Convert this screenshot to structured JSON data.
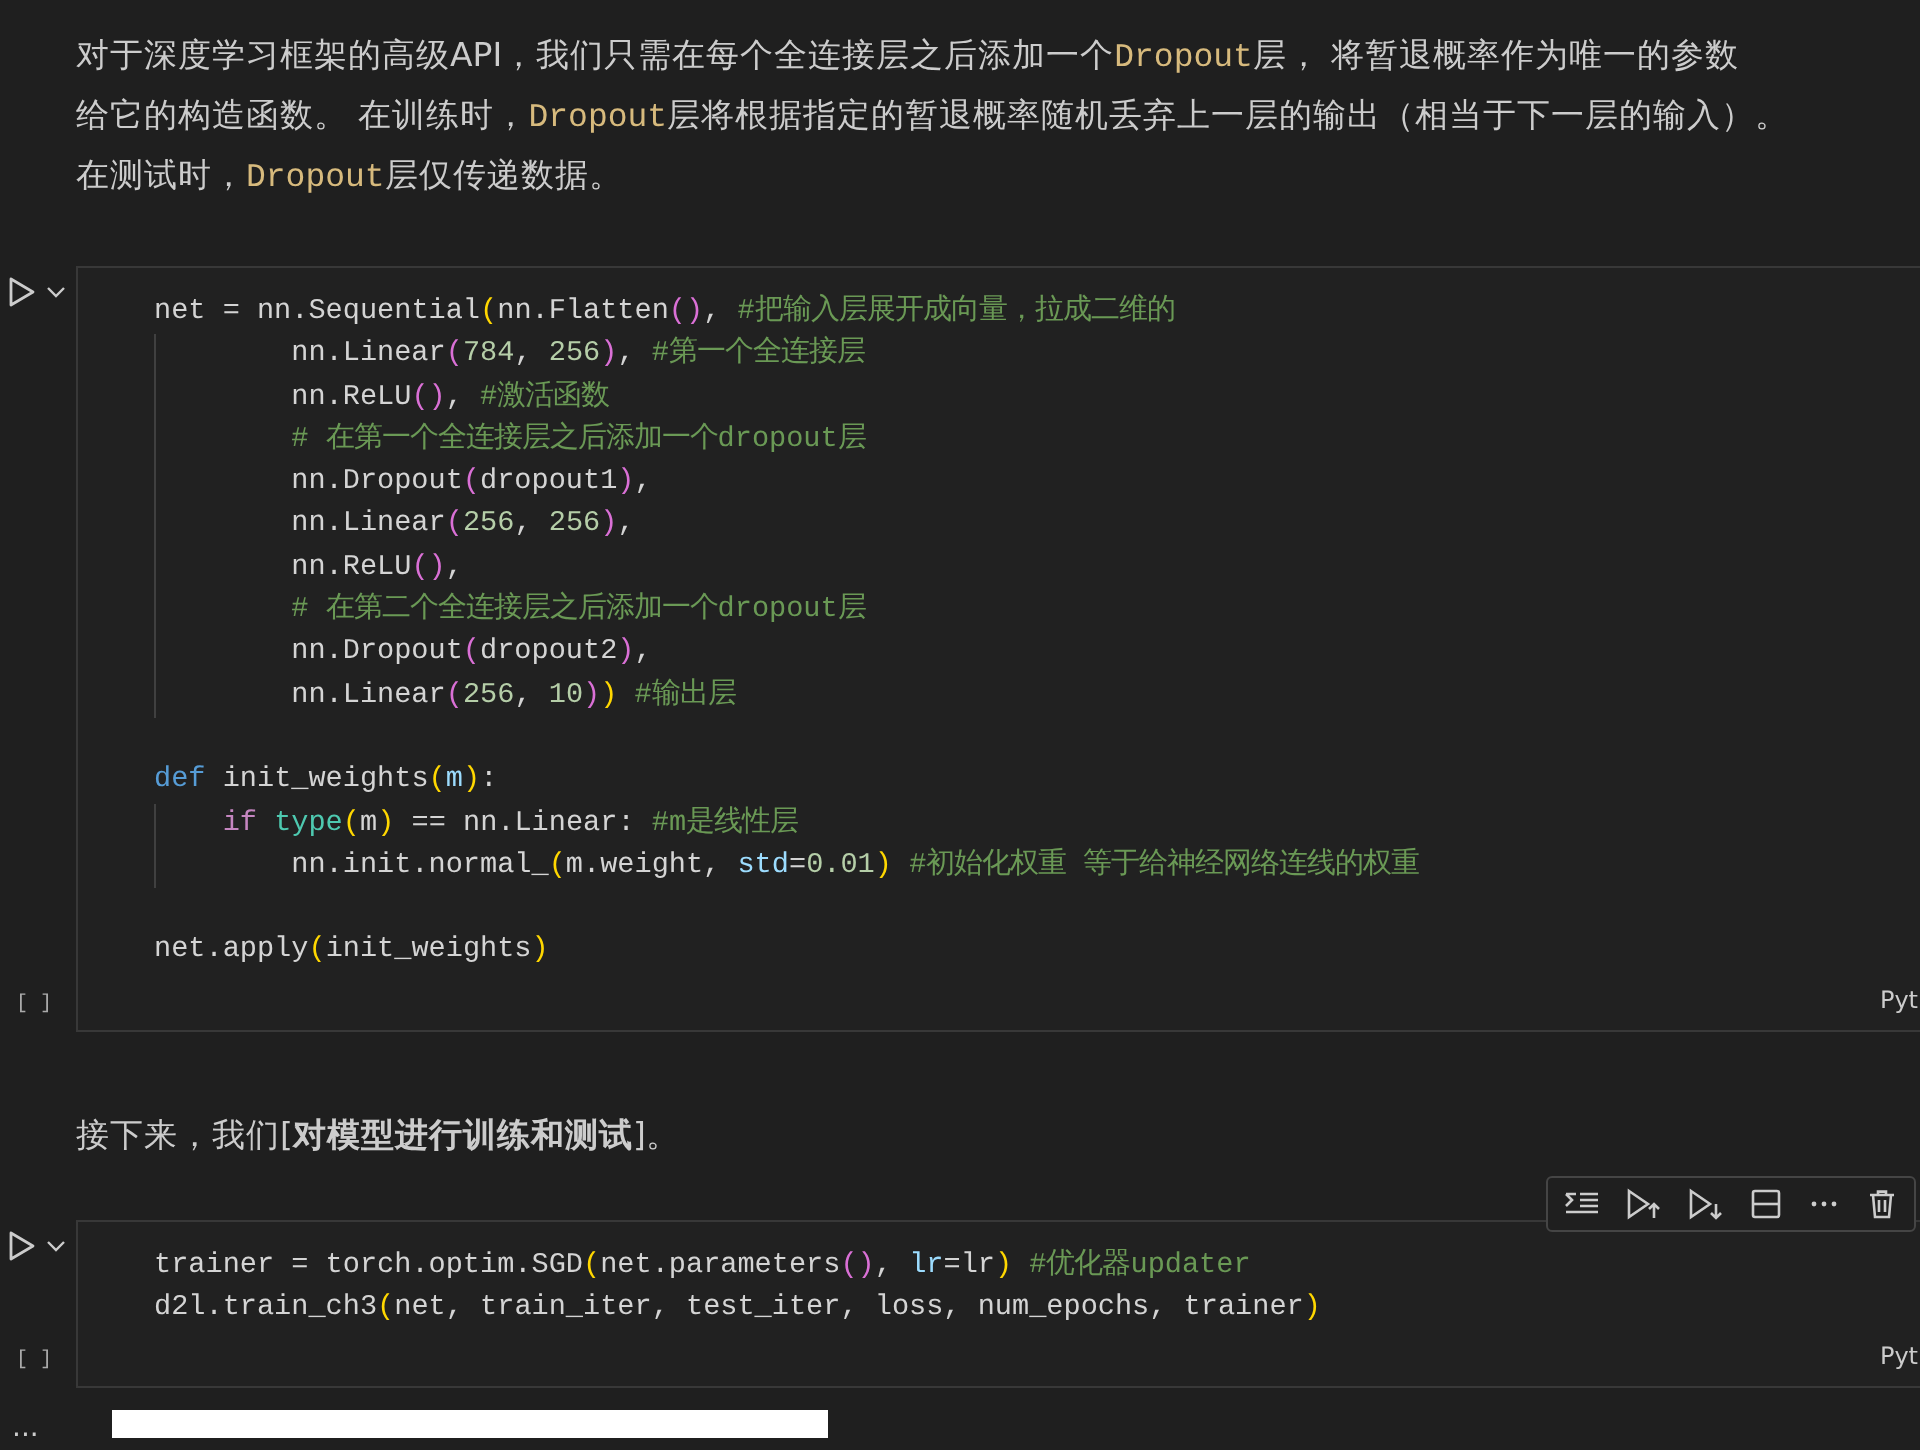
{
  "cells": [
    {
      "kind": "markdown",
      "lines": [
        [
          {
            "kind": "text",
            "text": "对于深度学习框架的高级API，我们只需在每个全连接层之后添加一个"
          },
          {
            "kind": "code",
            "text": "Dropout"
          },
          {
            "kind": "text",
            "text": "层， 将暂退概率作为唯一的参数"
          }
        ],
        [
          {
            "kind": "text",
            "text": "给它的构造函数。 在训练时，"
          },
          {
            "kind": "code",
            "text": "Dropout"
          },
          {
            "kind": "text",
            "text": "层将根据指定的暂退概率随机丢弃上一层的输出（相当于下一层的输入）。"
          }
        ],
        [
          {
            "kind": "text",
            "text": "在测试时，"
          },
          {
            "kind": "code",
            "text": "Dropout"
          },
          {
            "kind": "text",
            "text": "层仅传递数据。"
          }
        ]
      ]
    },
    {
      "kind": "code",
      "exec_label": "[ ]",
      "language": "Pyt",
      "lines": [
        {
          "kind": "code",
          "tokens": [
            {
              "kind": "plain",
              "text": "net = nn.Sequential"
            },
            {
              "kind": "b1",
              "text": "("
            },
            {
              "kind": "plain",
              "text": "nn.Flatten"
            },
            {
              "kind": "b2",
              "text": "()"
            },
            {
              "kind": "plain",
              "text": ", "
            },
            {
              "kind": "comment",
              "text": "#把输入层展开成向量，拉成二维的"
            }
          ]
        },
        {
          "kind": "indent2",
          "tokens": [
            {
              "kind": "plain",
              "text": "nn.Linear"
            },
            {
              "kind": "b2",
              "text": "("
            },
            {
              "kind": "number",
              "text": "784"
            },
            {
              "kind": "plain",
              "text": ", "
            },
            {
              "kind": "number",
              "text": "256"
            },
            {
              "kind": "b2",
              "text": ")"
            },
            {
              "kind": "plain",
              "text": ", "
            },
            {
              "kind": "comment",
              "text": "#第一个全连接层"
            }
          ]
        },
        {
          "kind": "indent2",
          "tokens": [
            {
              "kind": "plain",
              "text": "nn.ReLU"
            },
            {
              "kind": "b2",
              "text": "()"
            },
            {
              "kind": "plain",
              "text": ", "
            },
            {
              "kind": "comment",
              "text": "#激活函数"
            }
          ]
        },
        {
          "kind": "indent2",
          "tokens": [
            {
              "kind": "comment",
              "text": "# 在第一个全连接层之后添加一个dropout层"
            }
          ]
        },
        {
          "kind": "indent2",
          "tokens": [
            {
              "kind": "plain",
              "text": "nn.Dropout"
            },
            {
              "kind": "b2",
              "text": "("
            },
            {
              "kind": "plain",
              "text": "dropout1"
            },
            {
              "kind": "b2",
              "text": ")"
            },
            {
              "kind": "plain",
              "text": ","
            }
          ]
        },
        {
          "kind": "indent2",
          "tokens": [
            {
              "kind": "plain",
              "text": "nn.Linear"
            },
            {
              "kind": "b2",
              "text": "("
            },
            {
              "kind": "number",
              "text": "256"
            },
            {
              "kind": "plain",
              "text": ", "
            },
            {
              "kind": "number",
              "text": "256"
            },
            {
              "kind": "b2",
              "text": ")"
            },
            {
              "kind": "plain",
              "text": ","
            }
          ]
        },
        {
          "kind": "indent2",
          "tokens": [
            {
              "kind": "plain",
              "text": "nn.ReLU"
            },
            {
              "kind": "b2",
              "text": "()"
            },
            {
              "kind": "plain",
              "text": ","
            }
          ]
        },
        {
          "kind": "indent2",
          "tokens": [
            {
              "kind": "comment",
              "text": "# 在第二个全连接层之后添加一个dropout层"
            }
          ]
        },
        {
          "kind": "indent2",
          "tokens": [
            {
              "kind": "plain",
              "text": "nn.Dropout"
            },
            {
              "kind": "b2",
              "text": "("
            },
            {
              "kind": "plain",
              "text": "dropout2"
            },
            {
              "kind": "b2",
              "text": ")"
            },
            {
              "kind": "plain",
              "text": ","
            }
          ]
        },
        {
          "kind": "indent2",
          "tokens": [
            {
              "kind": "plain",
              "text": "nn.Linear"
            },
            {
              "kind": "b2",
              "text": "("
            },
            {
              "kind": "number",
              "text": "256"
            },
            {
              "kind": "plain",
              "text": ", "
            },
            {
              "kind": "number",
              "text": "10"
            },
            {
              "kind": "b2",
              "text": ")"
            },
            {
              "kind": "b1",
              "text": ") "
            },
            {
              "kind": "comment",
              "text": "#输出层"
            }
          ]
        },
        {
          "kind": "blank"
        },
        {
          "kind": "code",
          "tokens": [
            {
              "kind": "keyword",
              "text": "def"
            },
            {
              "kind": "plain",
              "text": " init_weights"
            },
            {
              "kind": "b1",
              "text": "("
            },
            {
              "kind": "param",
              "text": "m"
            },
            {
              "kind": "b1",
              "text": ")"
            },
            {
              "kind": "plain",
              "text": ":"
            }
          ]
        },
        {
          "kind": "indent1",
          "tokens": [
            {
              "kind": "control",
              "text": "if "
            },
            {
              "kind": "builtin",
              "text": "type"
            },
            {
              "kind": "b1",
              "text": "("
            },
            {
              "kind": "plain",
              "text": "m"
            },
            {
              "kind": "b1",
              "text": ")"
            },
            {
              "kind": "plain",
              "text": " == nn.Linear: "
            },
            {
              "kind": "comment",
              "text": "#m是线性层"
            }
          ]
        },
        {
          "kind": "indent2",
          "tokens": [
            {
              "kind": "plain",
              "text": "nn.init.normal_"
            },
            {
              "kind": "b1",
              "text": "("
            },
            {
              "kind": "plain",
              "text": "m.weight, "
            },
            {
              "kind": "param",
              "text": "std"
            },
            {
              "kind": "plain",
              "text": "="
            },
            {
              "kind": "number",
              "text": "0.01"
            },
            {
              "kind": "b1",
              "text": ") "
            },
            {
              "kind": "comment",
              "text": "#初始化权重 等于给神经网络连线的权重"
            }
          ]
        },
        {
          "kind": "blank"
        },
        {
          "kind": "code",
          "tokens": [
            {
              "kind": "plain",
              "text": "net.apply"
            },
            {
              "kind": "b1",
              "text": "("
            },
            {
              "kind": "plain",
              "text": "init_weights"
            },
            {
              "kind": "b1",
              "text": ")"
            }
          ]
        }
      ]
    },
    {
      "kind": "markdown",
      "rich": "接下来，我们[**对模型进行训练和测试**]。"
    },
    {
      "kind": "code",
      "exec_label": "[ ]",
      "language": "Pyt",
      "toolbar_shown": true,
      "lines": [
        {
          "kind": "code",
          "tokens": [
            {
              "kind": "plain",
              "text": "trainer = torch.optim.SGD"
            },
            {
              "kind": "b1",
              "text": "("
            },
            {
              "kind": "plain",
              "text": "net.parameters"
            },
            {
              "kind": "b2",
              "text": "()"
            },
            {
              "kind": "plain",
              "text": ", "
            },
            {
              "kind": "param",
              "text": "lr"
            },
            {
              "kind": "plain",
              "text": "=lr"
            },
            {
              "kind": "b1",
              "text": ") "
            },
            {
              "kind": "comment",
              "text": "#优化器updater"
            }
          ]
        },
        {
          "kind": "code",
          "tokens": [
            {
              "kind": "plain",
              "text": "d2l.train_ch3"
            },
            {
              "kind": "b1",
              "text": "("
            },
            {
              "kind": "plain",
              "text": "net, train_iter, test_iter, loss, num_epochs, trainer"
            },
            {
              "kind": "b1",
              "text": ")"
            }
          ]
        }
      ],
      "output": {
        "more": "..."
      }
    }
  ]
}
